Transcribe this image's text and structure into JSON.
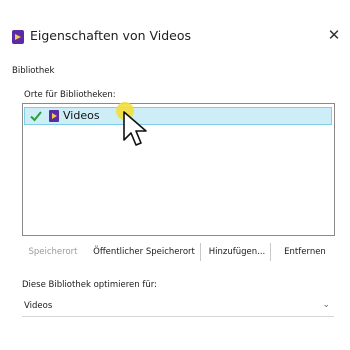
{
  "window": {
    "title": "Eigenschaften von Videos",
    "close_glyph": "✕"
  },
  "tab": {
    "label": "Bibliothek"
  },
  "locations": {
    "label": "Orte für Bibliotheken:",
    "items": [
      {
        "label": "Videos",
        "selected": true,
        "checked": true,
        "icon": "video-library-icon"
      }
    ]
  },
  "buttons": {
    "save_location": "Speicherort",
    "public_save_location": "Öffentlicher Speicherort",
    "add": "Hinzufügen...",
    "remove": "Entfernen"
  },
  "optimize": {
    "label": "Diese Bibliothek optimieren für:",
    "value": "Videos"
  },
  "colors": {
    "accent_selection": "#cdeef7",
    "library_icon": "#5b2aa6",
    "check": "#2e9e3a"
  }
}
